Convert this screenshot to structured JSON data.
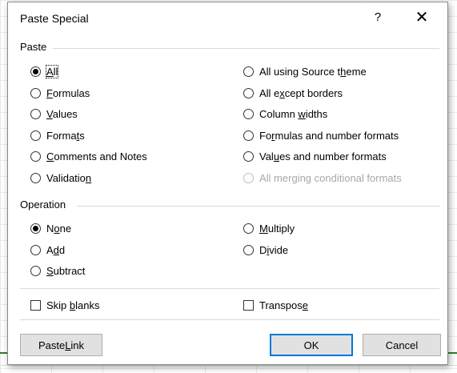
{
  "dialog": {
    "title": "Paste Special",
    "help": "?",
    "close": "✕"
  },
  "paste": {
    "label": "Paste",
    "selected": "All",
    "options_left": [
      {
        "pre": "",
        "u": "A",
        "post": "ll"
      },
      {
        "pre": "",
        "u": "F",
        "post": "ormulas"
      },
      {
        "pre": "",
        "u": "V",
        "post": "alues"
      },
      {
        "pre": "Forma",
        "u": "t",
        "post": "s"
      },
      {
        "pre": "",
        "u": "C",
        "post": "omments and Notes"
      },
      {
        "pre": "Validatio",
        "u": "n",
        "post": ""
      }
    ],
    "options_right": [
      {
        "pre": "All using Source t",
        "u": "h",
        "post": "eme"
      },
      {
        "pre": "All e",
        "u": "x",
        "post": "cept borders"
      },
      {
        "pre": "Column ",
        "u": "w",
        "post": "idths"
      },
      {
        "pre": "Fo",
        "u": "r",
        "post": "mulas and number formats"
      },
      {
        "pre": "Val",
        "u": "u",
        "post": "es and number formats"
      },
      {
        "pre": "All merging conditional formats",
        "u": "",
        "post": ""
      }
    ]
  },
  "operation": {
    "label": "Operation",
    "selected": "None",
    "options_left": [
      {
        "pre": "N",
        "u": "o",
        "post": "ne"
      },
      {
        "pre": "A",
        "u": "d",
        "post": "d"
      },
      {
        "pre": "",
        "u": "S",
        "post": "ubtract"
      }
    ],
    "options_right": [
      {
        "pre": "",
        "u": "M",
        "post": "ultiply"
      },
      {
        "pre": "D",
        "u": "i",
        "post": "vide"
      }
    ]
  },
  "checks": {
    "skip_blanks": {
      "pre": "Skip ",
      "u": "b",
      "post": "lanks",
      "checked": false
    },
    "transpose": {
      "pre": "Transpos",
      "u": "e",
      "post": "",
      "checked": false
    }
  },
  "buttons": {
    "paste_link": {
      "pre": "Paste ",
      "u": "L",
      "post": "ink"
    },
    "ok": "OK",
    "cancel": "Cancel"
  }
}
